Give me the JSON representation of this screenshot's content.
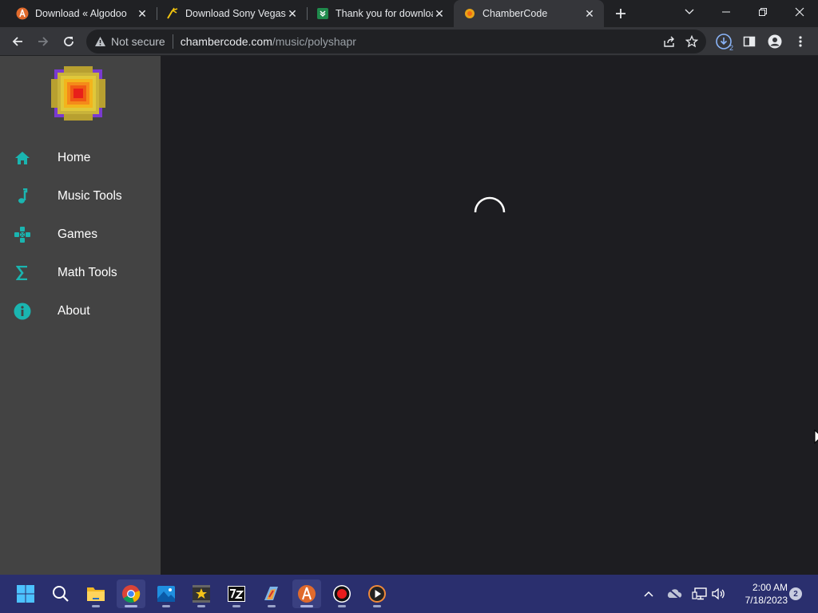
{
  "browser": {
    "tabs": [
      {
        "title": "Download « Algodoo",
        "favicon": "algodoo-icon",
        "active": false
      },
      {
        "title": "Download Sony Vegas",
        "favicon": "vegas-icon",
        "active": false
      },
      {
        "title": "Thank you for downloa",
        "favicon": "download-site-icon",
        "active": false
      },
      {
        "title": "ChamberCode",
        "favicon": "chambercode-icon",
        "active": true
      }
    ],
    "security_label": "Not secure",
    "url_host": "chambercode.com",
    "url_path": "/music/polyshapr",
    "downloads_badge": "2"
  },
  "sidebar": {
    "items": [
      {
        "label": "Home",
        "icon": "home-icon"
      },
      {
        "label": "Music Tools",
        "icon": "music-note-icon"
      },
      {
        "label": "Games",
        "icon": "gamepad-icon"
      },
      {
        "label": "Math Tools",
        "icon": "sigma-icon"
      },
      {
        "label": "About",
        "icon": "info-icon"
      }
    ],
    "icon_color": "#1ab5b0",
    "background": "#434343"
  },
  "main": {
    "state": "loading",
    "background": "#1d1d21"
  },
  "taskbar": {
    "apps": [
      "start-icon",
      "search-icon",
      "file-explorer-icon",
      "chrome-icon",
      "photos-icon",
      "movie-maker-icon",
      "7zip-icon",
      "paint-icon",
      "algodoo-icon",
      "record-icon",
      "media-player-icon"
    ],
    "time": "2:00 AM",
    "date": "7/18/2023",
    "notification_count": "2"
  }
}
